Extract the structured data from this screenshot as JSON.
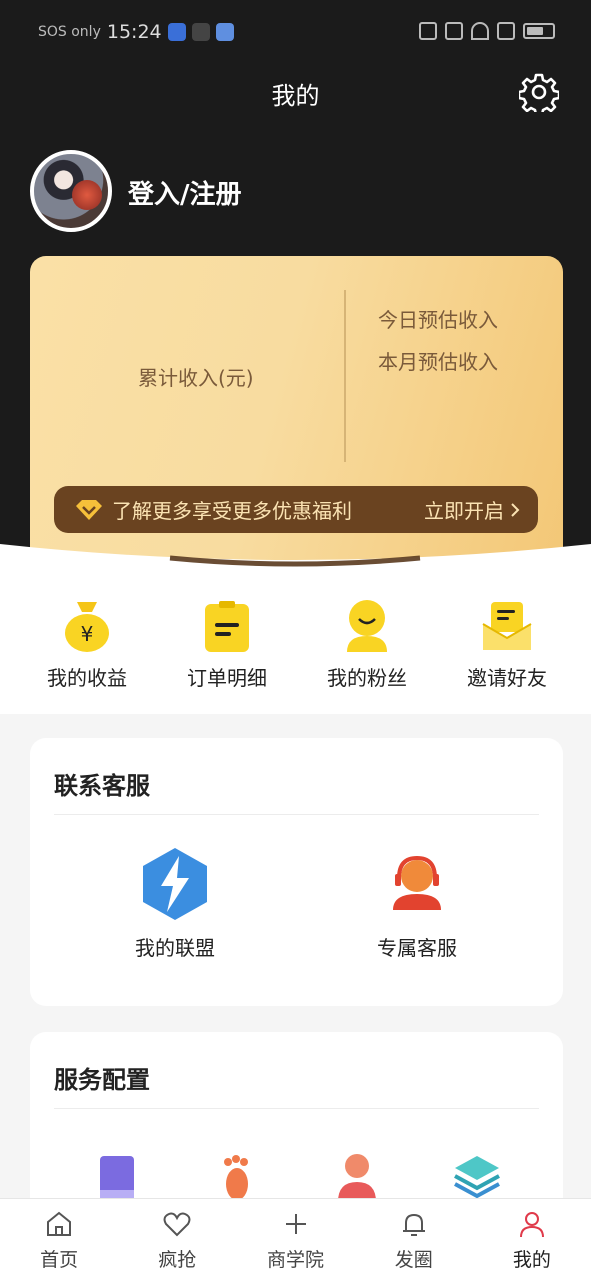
{
  "status_bar": {
    "carrier": "SOS only",
    "time": "15:24"
  },
  "header": {
    "title": "我的"
  },
  "profile": {
    "login_label": "登入/注册"
  },
  "earnings_card": {
    "total_label": "累计收入(元)",
    "today_label": "今日预估收入",
    "month_label": "本月预估收入",
    "promo_text": "了解更多享受更多优惠福利",
    "promo_action": "立即开启"
  },
  "quick_actions": [
    {
      "label": "我的收益",
      "icon": "money-bag-icon"
    },
    {
      "label": "订单明细",
      "icon": "clipboard-icon"
    },
    {
      "label": "我的粉丝",
      "icon": "fan-user-icon"
    },
    {
      "label": "邀请好友",
      "icon": "envelope-icon"
    }
  ],
  "contact_section": {
    "title": "联系客服",
    "items": [
      {
        "label": "我的联盟",
        "icon": "lightning-hexagon-icon"
      },
      {
        "label": "专属客服",
        "icon": "headset-agent-icon"
      }
    ]
  },
  "service_section": {
    "title": "服务配置",
    "items": [
      {
        "icon": "book-icon"
      },
      {
        "icon": "footprint-icon"
      },
      {
        "icon": "person-icon"
      },
      {
        "icon": "layers-icon"
      }
    ]
  },
  "tabbar": [
    {
      "label": "首页",
      "icon": "home-icon"
    },
    {
      "label": "疯抢",
      "icon": "heart-icon"
    },
    {
      "label": "商学院",
      "icon": "plus-icon"
    },
    {
      "label": "发圈",
      "icon": "bell-icon"
    },
    {
      "label": "我的",
      "icon": "user-icon",
      "active": true
    }
  ],
  "colors": {
    "accent": "#e03a4a",
    "gold": "#f3c776",
    "dark": "#1b1b1b",
    "vip_bar": "#6a4320"
  }
}
